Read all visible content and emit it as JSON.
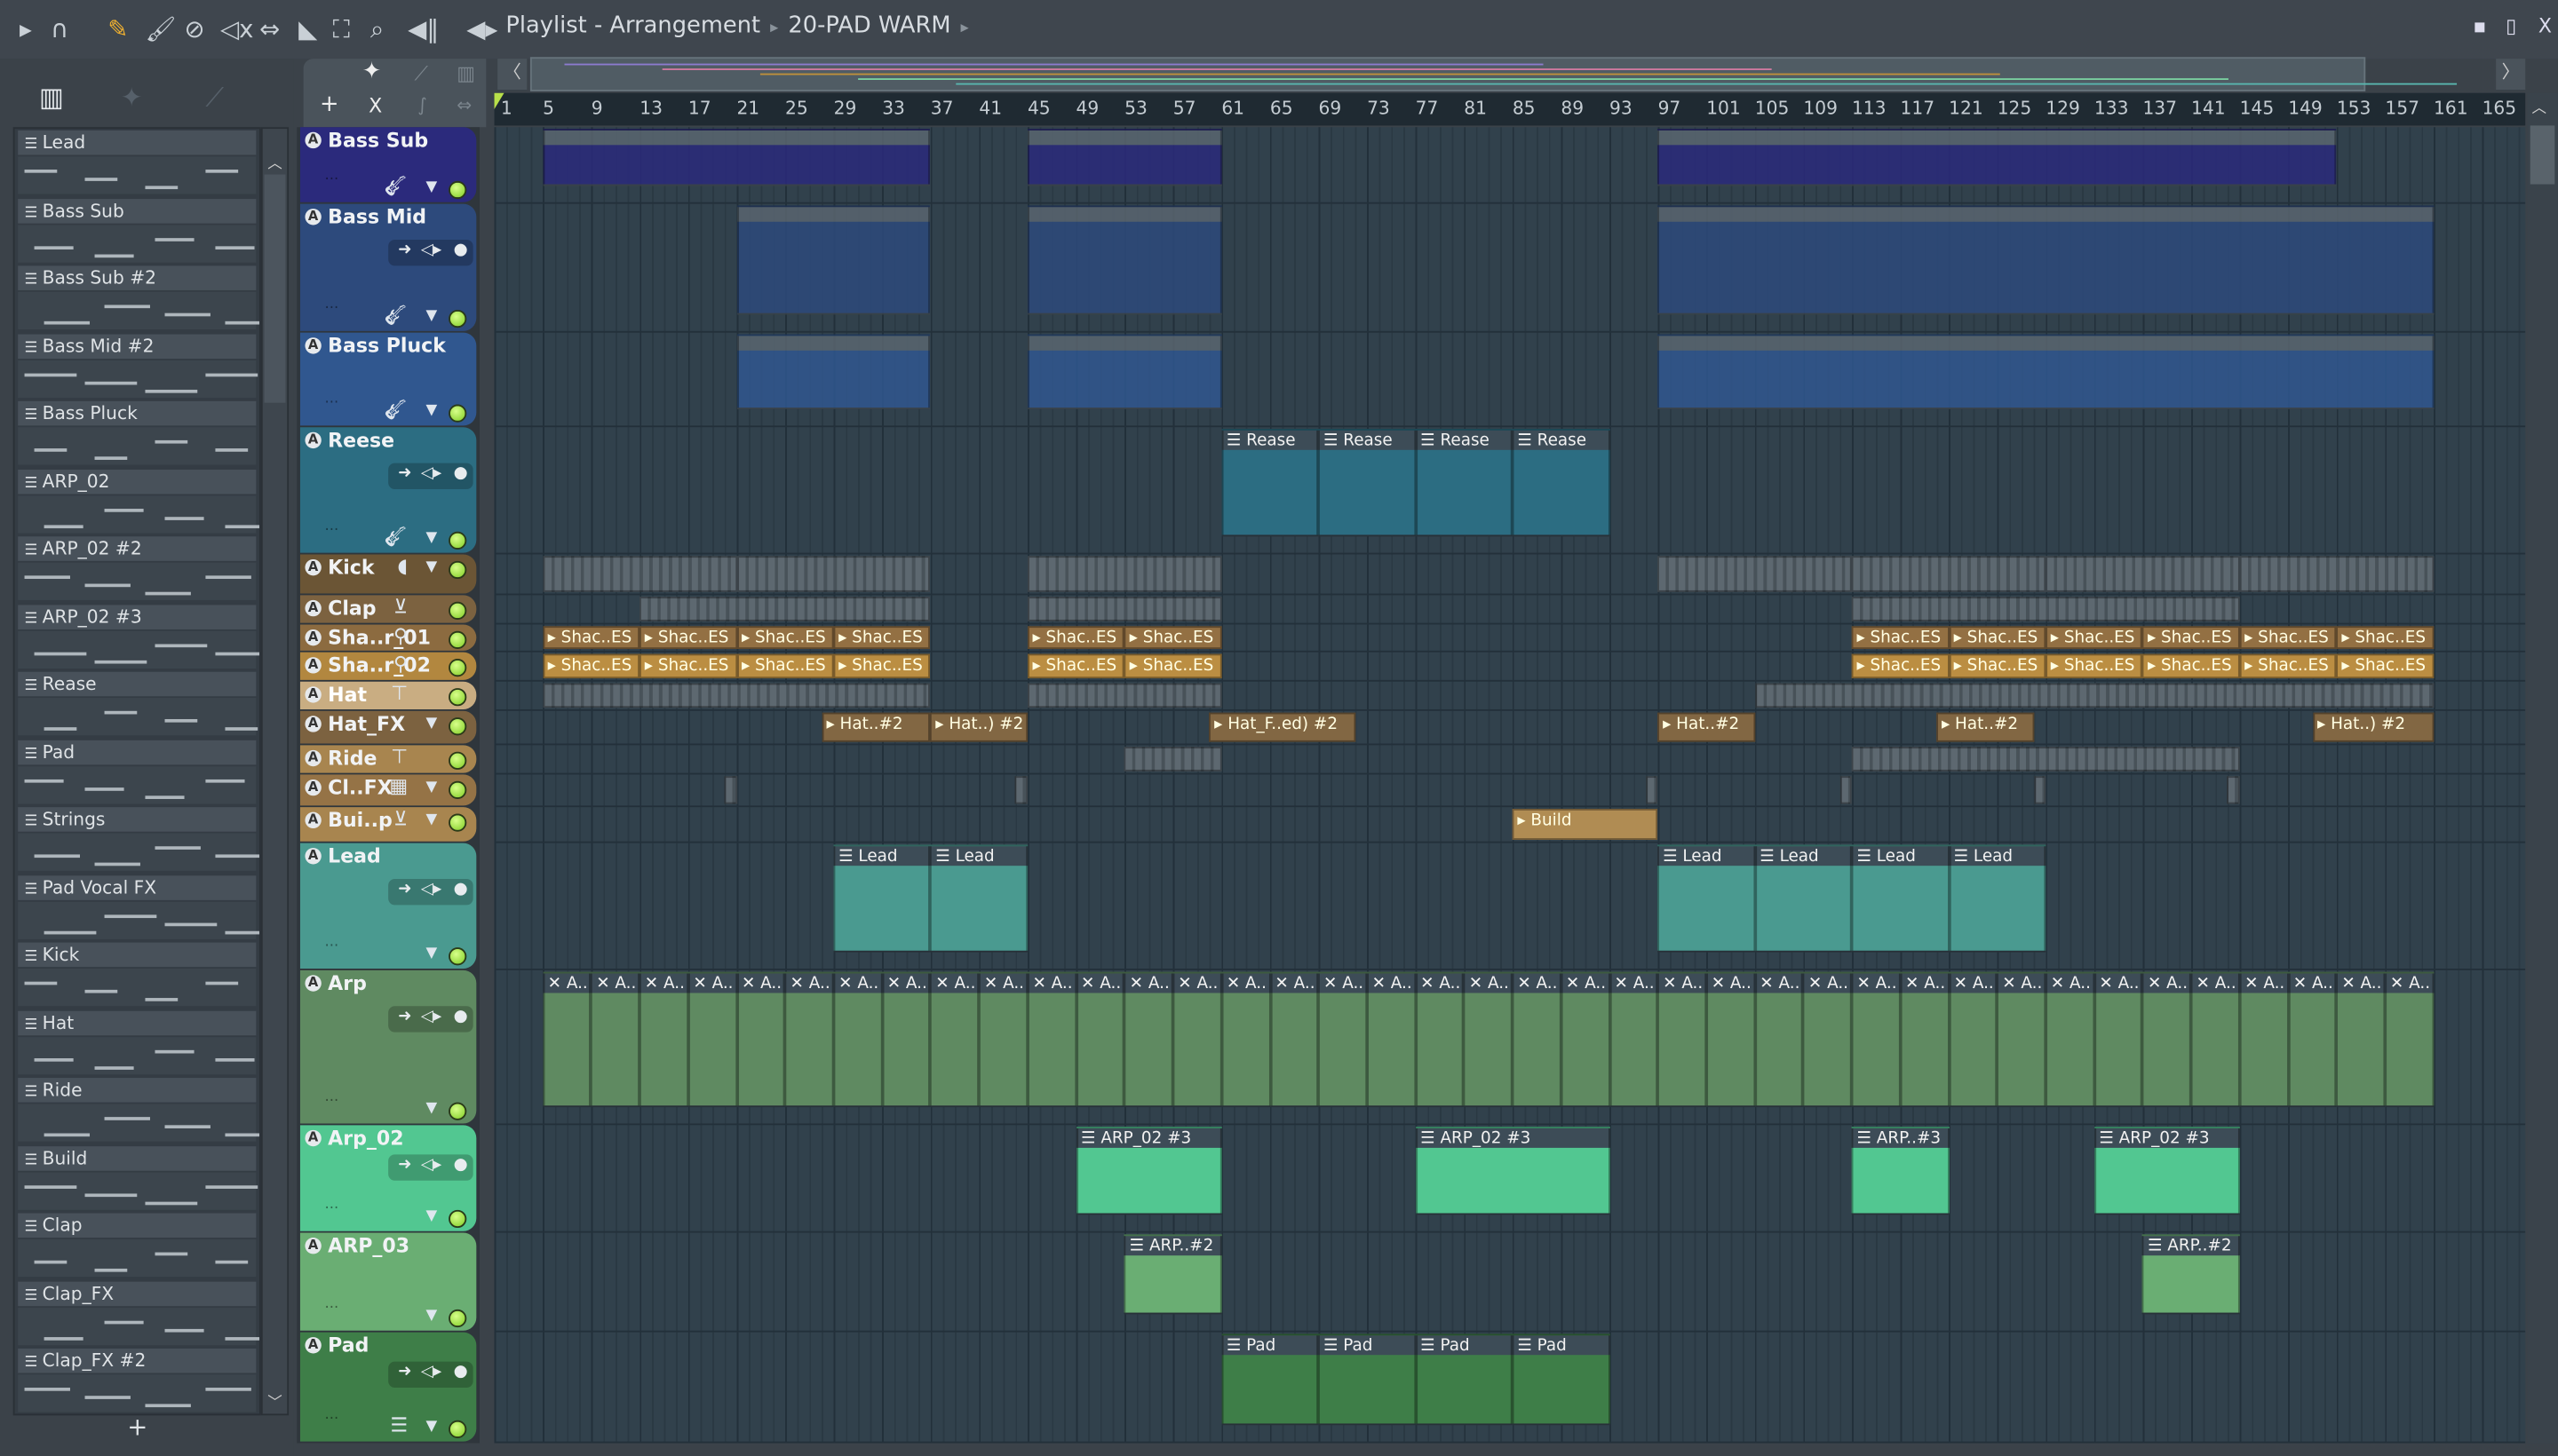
{
  "toolbar": {
    "icons": [
      "play-arrow",
      "magnet",
      "pencil",
      "paint-brush",
      "delete",
      "mute",
      "slip",
      "slice",
      "select",
      "zoom",
      "playback"
    ],
    "title": "Playlist - Arrangement",
    "pattern": "20-PAD WARM"
  },
  "window": {
    "minimize": "▪",
    "maximize": "▯",
    "close": "X"
  },
  "left_panel": {
    "add_label": "+",
    "patterns": [
      {
        "name": "Lead"
      },
      {
        "name": "Bass Sub"
      },
      {
        "name": "Bass Sub #2"
      },
      {
        "name": "Bass Mid #2"
      },
      {
        "name": "Bass Pluck"
      },
      {
        "name": "ARP_02"
      },
      {
        "name": "ARP_02 #2"
      },
      {
        "name": "ARP_02 #3"
      },
      {
        "name": "Rease"
      },
      {
        "name": "Pad"
      },
      {
        "name": "Strings"
      },
      {
        "name": "Pad Vocal FX"
      },
      {
        "name": "Kick"
      },
      {
        "name": "Hat"
      },
      {
        "name": "Ride"
      },
      {
        "name": "Build"
      },
      {
        "name": "Clap"
      },
      {
        "name": "Clap_FX"
      },
      {
        "name": "Clap_FX #2"
      }
    ]
  },
  "header_controls": {
    "add": "+",
    "close": "X"
  },
  "ruler": {
    "ticks": [
      1,
      5,
      9,
      13,
      17,
      21,
      25,
      29,
      33,
      37,
      41,
      45,
      49,
      53,
      57,
      61,
      65,
      69,
      73,
      77,
      81,
      85,
      89,
      93,
      97,
      101,
      105,
      109,
      113,
      117,
      121,
      125,
      129,
      133,
      137,
      141,
      145,
      149,
      153,
      157,
      161,
      165
    ]
  },
  "tracks": [
    {
      "name": "Bass Sub",
      "color": "#2b2a7c",
      "instrument": "guitar",
      "clips": [
        {
          "s": 5,
          "l": 32,
          "label": ""
        },
        {
          "s": 45,
          "l": 16,
          "label": ""
        },
        {
          "s": 97,
          "l": 56,
          "label": ""
        }
      ]
    },
    {
      "name": "Bass Mid",
      "color": "#2d4a7c",
      "instrument": "guitar",
      "clips": [
        {
          "s": 21,
          "l": 16,
          "label": ""
        },
        {
          "s": 45,
          "l": 16,
          "label": ""
        },
        {
          "s": 97,
          "l": 64,
          "label": ""
        }
      ]
    },
    {
      "name": "Bass Pluck",
      "color": "#30578f",
      "instrument": "guitar",
      "clips": [
        {
          "s": 21,
          "l": 16,
          "label": ""
        },
        {
          "s": 45,
          "l": 16,
          "label": ""
        },
        {
          "s": 97,
          "l": 64,
          "label": ""
        }
      ]
    },
    {
      "name": "Reese",
      "color": "#2c6d82",
      "instrument": "guitar",
      "clips": [
        {
          "s": 61,
          "l": 8,
          "label": "Rease"
        },
        {
          "s": 69,
          "l": 8,
          "label": "Rease"
        },
        {
          "s": 77,
          "l": 8,
          "label": "Rease"
        },
        {
          "s": 85,
          "l": 8,
          "label": "Rease"
        }
      ]
    },
    {
      "name": "Kick",
      "color": "#6b5535",
      "instrument": "kick",
      "clips": [
        {
          "s": 5,
          "l": 16,
          "label": ""
        },
        {
          "s": 21,
          "l": 16,
          "label": ""
        },
        {
          "s": 45,
          "l": 16,
          "label": ""
        },
        {
          "s": 97,
          "l": 16,
          "label": ""
        },
        {
          "s": 113,
          "l": 16,
          "label": ""
        },
        {
          "s": 129,
          "l": 16,
          "label": ""
        },
        {
          "s": 145,
          "l": 16,
          "label": ""
        }
      ]
    },
    {
      "name": "Clap",
      "color": "#7c6240",
      "instrument": "drum",
      "clips": [
        {
          "s": 13,
          "l": 24,
          "label": ""
        },
        {
          "s": 45,
          "l": 16,
          "label": ""
        },
        {
          "s": 113,
          "l": 32,
          "label": ""
        }
      ]
    },
    {
      "name": "Sha..r_01",
      "color": "#8c6b40",
      "instrument": "maraca",
      "clips": [
        {
          "s": 5,
          "l": 8,
          "label": "Shac..ES"
        },
        {
          "s": 13,
          "l": 8,
          "label": "Shac..ES"
        },
        {
          "s": 21,
          "l": 8,
          "label": "Shac..ES"
        },
        {
          "s": 29,
          "l": 8,
          "label": "Shac..ES"
        },
        {
          "s": 45,
          "l": 8,
          "label": "Shac..ES"
        },
        {
          "s": 53,
          "l": 8,
          "label": "Shac..ES"
        },
        {
          "s": 113,
          "l": 8,
          "label": "Shac..ES"
        },
        {
          "s": 121,
          "l": 8,
          "label": "Shac..ES"
        },
        {
          "s": 129,
          "l": 8,
          "label": "Shac..ES"
        },
        {
          "s": 137,
          "l": 8,
          "label": "Shac..ES"
        },
        {
          "s": 145,
          "l": 8,
          "label": "Shac..ES"
        },
        {
          "s": 153,
          "l": 8,
          "label": "Shac..ES"
        }
      ]
    },
    {
      "name": "Sha..r_02",
      "color": "#b2873f",
      "instrument": "maraca",
      "clips": [
        {
          "s": 5,
          "l": 8,
          "label": "Shac..ES"
        },
        {
          "s": 13,
          "l": 8,
          "label": "Shac..ES"
        },
        {
          "s": 21,
          "l": 8,
          "label": "Shac..ES"
        },
        {
          "s": 29,
          "l": 8,
          "label": "Shac..ES"
        },
        {
          "s": 45,
          "l": 8,
          "label": "Shac..ES"
        },
        {
          "s": 53,
          "l": 8,
          "label": "Shac..ES"
        },
        {
          "s": 113,
          "l": 8,
          "label": "Shac..ES"
        },
        {
          "s": 121,
          "l": 8,
          "label": "Shac..ES"
        },
        {
          "s": 129,
          "l": 8,
          "label": "Shac..ES"
        },
        {
          "s": 137,
          "l": 8,
          "label": "Shac..ES"
        },
        {
          "s": 145,
          "l": 8,
          "label": "Shac..ES"
        },
        {
          "s": 153,
          "l": 8,
          "label": "Shac..ES"
        }
      ]
    },
    {
      "name": "Hat",
      "color": "#c9ad82",
      "instrument": "cymbal",
      "clips": [
        {
          "s": 5,
          "l": 32,
          "label": ""
        },
        {
          "s": 45,
          "l": 16,
          "label": ""
        },
        {
          "s": 105,
          "l": 56,
          "label": ""
        }
      ]
    },
    {
      "name": "Hat_FX",
      "color": "#7c6240",
      "instrument": "",
      "clips": [
        {
          "s": 28,
          "l": 9,
          "label": "Hat..#2"
        },
        {
          "s": 37,
          "l": 8,
          "label": "Hat..) #2"
        },
        {
          "s": 60,
          "l": 12,
          "label": "Hat_F..ed) #2"
        },
        {
          "s": 97,
          "l": 8,
          "label": "Hat..#2"
        },
        {
          "s": 120,
          "l": 8,
          "label": "Hat..#2"
        },
        {
          "s": 151,
          "l": 10,
          "label": "Hat..) #2"
        }
      ]
    },
    {
      "name": "Ride",
      "color": "#a8854f",
      "instrument": "cymbal",
      "clips": [
        {
          "s": 53,
          "l": 8,
          "label": ""
        },
        {
          "s": 113,
          "l": 32,
          "label": ""
        }
      ]
    },
    {
      "name": "Cl..FX",
      "color": "#957346",
      "instrument": "machine",
      "clips": [
        {
          "s": 20,
          "l": 1,
          "label": ""
        },
        {
          "s": 44,
          "l": 1,
          "label": ""
        },
        {
          "s": 96,
          "l": 1,
          "label": ""
        },
        {
          "s": 112,
          "l": 1,
          "label": ""
        },
        {
          "s": 128,
          "l": 1,
          "label": ""
        },
        {
          "s": 144,
          "l": 1,
          "label": ""
        }
      ]
    },
    {
      "name": "Bui..p",
      "color": "#a8854f",
      "instrument": "drum",
      "clips": [
        {
          "s": 85,
          "l": 12,
          "label": "Build"
        }
      ]
    },
    {
      "name": "Lead",
      "color": "#4a9a90",
      "instrument": "",
      "clips": [
        {
          "s": 29,
          "l": 8,
          "label": "Lead"
        },
        {
          "s": 37,
          "l": 8,
          "label": "Lead"
        },
        {
          "s": 97,
          "l": 8,
          "label": "Lead"
        },
        {
          "s": 105,
          "l": 8,
          "label": "Lead"
        },
        {
          "s": 113,
          "l": 8,
          "label": "Lead"
        },
        {
          "s": 121,
          "l": 8,
          "label": "Lead"
        }
      ]
    },
    {
      "name": "Arp",
      "color": "#5f8a61",
      "instrument": "",
      "repeat": {
        "start": 5,
        "end": 161,
        "step": 4,
        "label": "A.."
      },
      "clips": []
    },
    {
      "name": "Arp_02",
      "color": "#52c791",
      "instrument": "",
      "clips": [
        {
          "s": 49,
          "l": 12,
          "label": "ARP_02 #3"
        },
        {
          "s": 77,
          "l": 16,
          "label": "ARP_02 #3"
        },
        {
          "s": 113,
          "l": 8,
          "label": "ARP..#3"
        },
        {
          "s": 133,
          "l": 12,
          "label": "ARP_02 #3"
        }
      ]
    },
    {
      "name": "ARP_03",
      "color": "#6aae73",
      "instrument": "",
      "clips": [
        {
          "s": 53,
          "l": 8,
          "label": "ARP..#2"
        },
        {
          "s": 137,
          "l": 8,
          "label": "ARP..#2"
        }
      ]
    },
    {
      "name": "Pad",
      "color": "#3e7e48",
      "instrument": "pattern",
      "clips": [
        {
          "s": 61,
          "l": 8,
          "label": "Pad"
        },
        {
          "s": 69,
          "l": 8,
          "label": "Pad"
        },
        {
          "s": 77,
          "l": 8,
          "label": "Pad"
        },
        {
          "s": 85,
          "l": 8,
          "label": "Pad"
        }
      ]
    }
  ]
}
